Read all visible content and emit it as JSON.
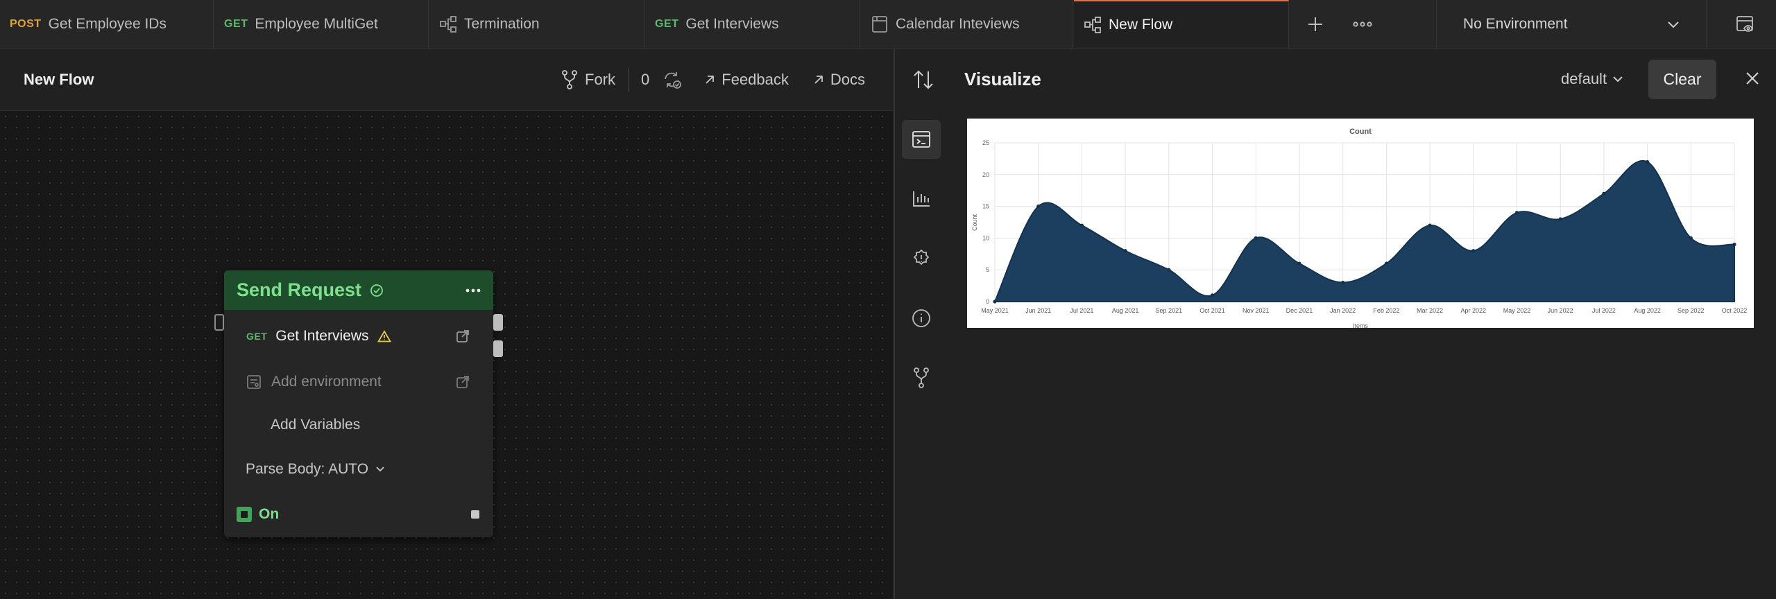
{
  "tabs": [
    {
      "method": "POST",
      "label": "Get Employee IDs"
    },
    {
      "method": "GET",
      "label": "Employee MultiGet"
    },
    {
      "icon": "flow-icon",
      "label": "Termination"
    },
    {
      "method": "GET",
      "label": "Get Interviews"
    },
    {
      "icon": "calendar-doc-icon",
      "label": "Calendar Inteviews"
    },
    {
      "icon": "flow-icon",
      "label": "New Flow",
      "active": true
    }
  ],
  "environment": {
    "selected": "No Environment"
  },
  "flow": {
    "title": "New Flow",
    "fork_label": "Fork",
    "fork_count": "0",
    "feedback_label": "Feedback",
    "docs_label": "Docs"
  },
  "node": {
    "title": "Send Request",
    "request_method": "GET",
    "request_name": "Get Interviews",
    "add_environment": "Add environment",
    "add_variables": "Add Variables",
    "parse_body": "Parse Body: AUTO",
    "toggle_label": "On"
  },
  "visualize": {
    "title": "Visualize",
    "template": "default",
    "clear_label": "Clear"
  },
  "colors": {
    "accent": "#e8703a",
    "get": "#5cb86a",
    "post": "#e0a33a",
    "node_green": "#1e4d2b",
    "chart_fill": "#1c3f5f"
  },
  "chart_data": {
    "type": "area",
    "title": "Count",
    "xlabel": "Items",
    "ylabel": "Count",
    "ylim": [
      0,
      25
    ],
    "yticks": [
      "0",
      "5",
      "10",
      "15",
      "20",
      "25"
    ],
    "categories": [
      "May 2021",
      "Jun 2021",
      "Jul 2021",
      "Aug 2021",
      "Sep 2021",
      "Oct 2021",
      "Nov 2021",
      "Dec 2021",
      "Jan 2022",
      "Feb 2022",
      "Mar 2022",
      "Apr 2022",
      "May 2022",
      "Jun 2022",
      "Jul 2022",
      "Aug 2022",
      "Sep 2022",
      "Oct 2022"
    ],
    "series": [
      {
        "values": [
          0,
          15,
          12,
          8,
          5,
          1,
          10,
          6,
          3,
          6,
          12,
          8,
          14,
          13,
          17,
          22,
          10,
          9
        ]
      }
    ],
    "grid": true
  }
}
